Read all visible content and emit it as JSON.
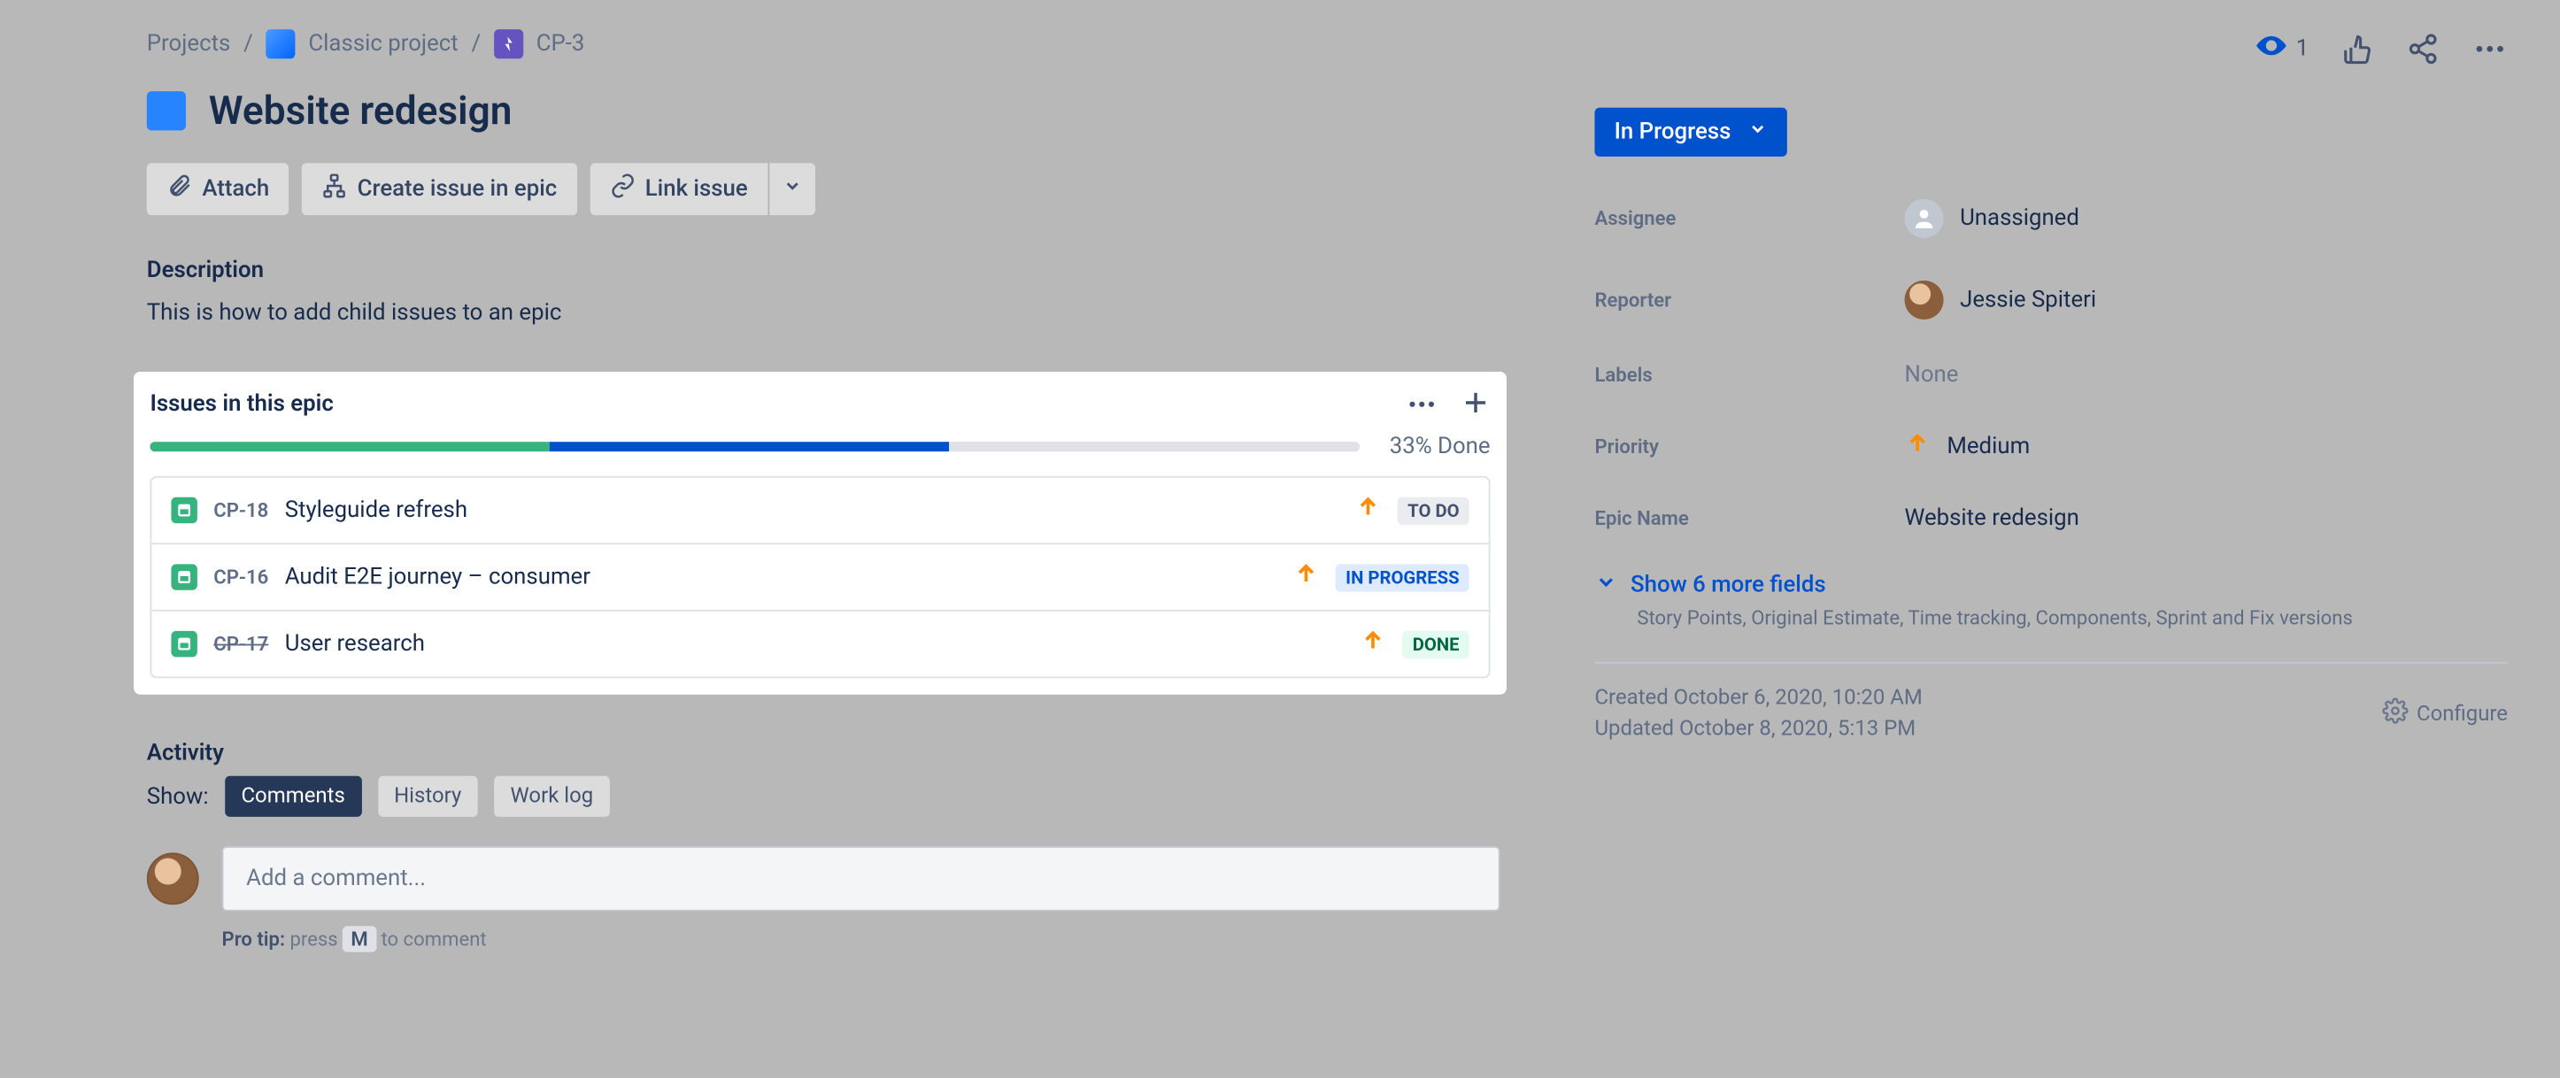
{
  "breadcrumbs": {
    "projects": "Projects",
    "project": "Classic project",
    "issue_key": "CP-3"
  },
  "issue": {
    "title": "Website redesign",
    "description_heading": "Description",
    "description_body": "This is how to add child issues to an epic"
  },
  "actions": {
    "attach": "Attach",
    "create_child": "Create issue in epic",
    "link": "Link issue"
  },
  "epic_panel": {
    "title": "Issues in this epic",
    "progress_label": "33% Done",
    "progress": {
      "done_pct": 33,
      "in_progress_pct": 33
    },
    "children": [
      {
        "key": "CP-18",
        "summary": "Styleguide refresh",
        "status_name": "TO DO",
        "status_class": "loz-todo",
        "key_done": false
      },
      {
        "key": "CP-16",
        "summary": "Audit E2E journey – consumer",
        "status_name": "IN PROGRESS",
        "status_class": "loz-inprog",
        "key_done": false
      },
      {
        "key": "CP-17",
        "summary": "User research",
        "status_name": "DONE",
        "status_class": "loz-done",
        "key_done": true
      }
    ]
  },
  "activity": {
    "heading": "Activity",
    "show_label": "Show:",
    "tabs": {
      "comments": "Comments",
      "history": "History",
      "worklog": "Work log"
    },
    "comment_placeholder": "Add a comment...",
    "protip_prefix": "Pro tip:",
    "protip_press": " press ",
    "protip_key": "M",
    "protip_suffix": " to comment"
  },
  "sidebar": {
    "status": "In Progress",
    "fields": {
      "assignee_label": "Assignee",
      "assignee_value": "Unassigned",
      "reporter_label": "Reporter",
      "reporter_value": "Jessie Spiteri",
      "labels_label": "Labels",
      "labels_value": "None",
      "priority_label": "Priority",
      "priority_value": "Medium",
      "epicname_label": "Epic Name",
      "epicname_value": "Website redesign"
    },
    "show_more_link": "Show 6 more fields",
    "show_more_desc": "Story Points, Original Estimate, Time tracking, Components, Sprint and Fix versions",
    "created": "Created October 6, 2020, 10:20 AM",
    "updated": "Updated October 8, 2020, 5:13 PM",
    "configure": "Configure"
  },
  "top_right": {
    "watch_count": "1"
  }
}
